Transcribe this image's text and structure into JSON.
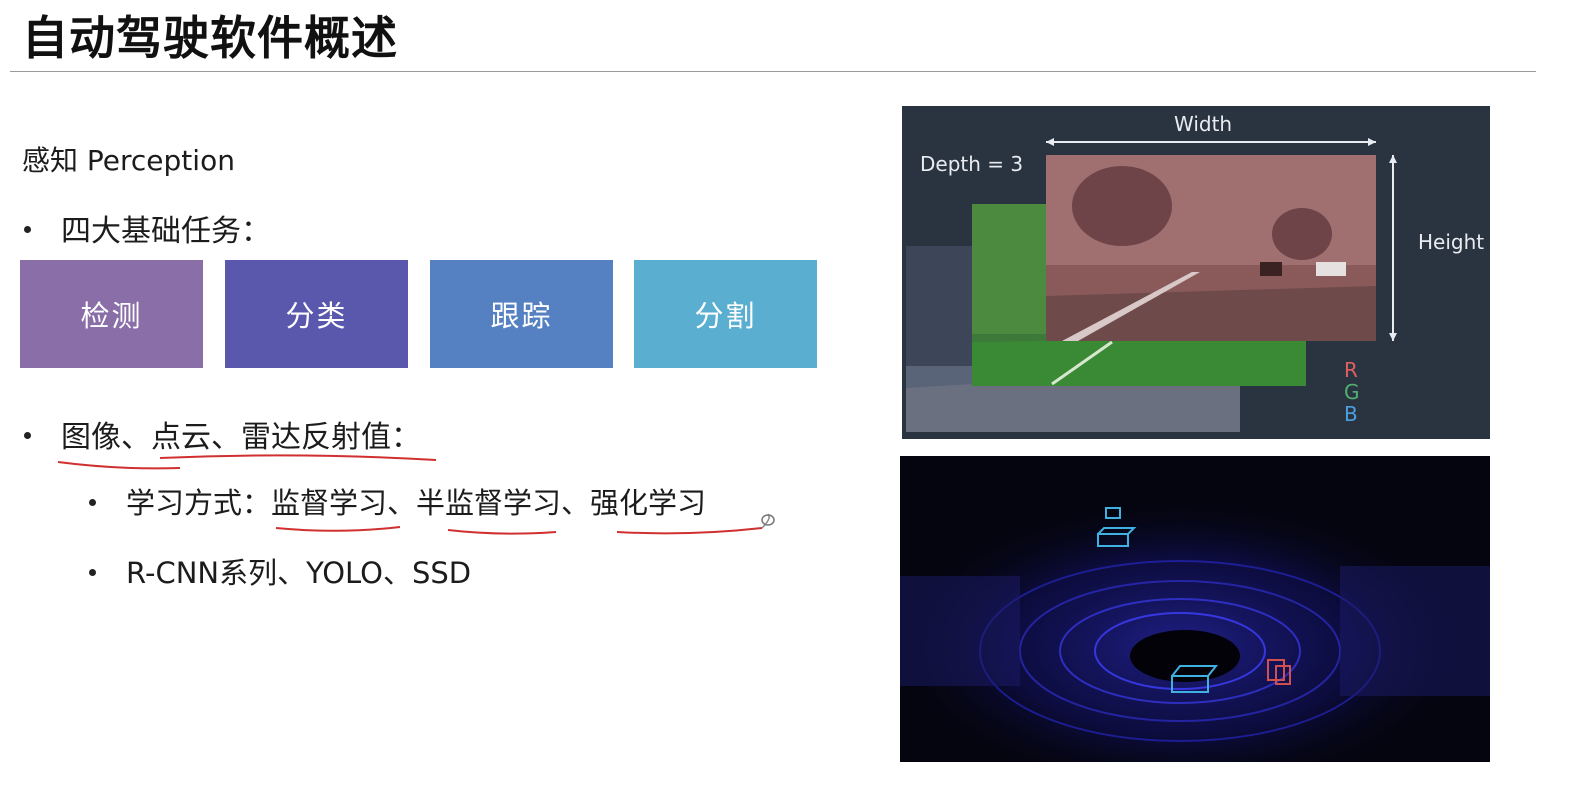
{
  "page": {
    "title": "自动驾驶软件概述"
  },
  "perception": {
    "heading": "感知 Perception",
    "tasks_label": "四大基础任务：",
    "tasks": [
      {
        "label": "检测",
        "color": "#8a6ea8"
      },
      {
        "label": "分类",
        "color": "#5a58ac"
      },
      {
        "label": "跟踪",
        "color": "#5580c2"
      },
      {
        "label": "分割",
        "color": "#5aaed0"
      }
    ],
    "data_sources_label": "图像、点云、雷达反射值：",
    "learning_label": "学习方式：监督学习、半监督学习、强化学习",
    "models_label": "R-CNN系列、YOLO、SSD"
  },
  "rgb_figure": {
    "width_label": "Width",
    "depth_label": "Depth = 3",
    "height_label": "Height",
    "channels": [
      "R",
      "G",
      "B"
    ]
  },
  "colors": {
    "annotation_underline": "#d03030"
  }
}
